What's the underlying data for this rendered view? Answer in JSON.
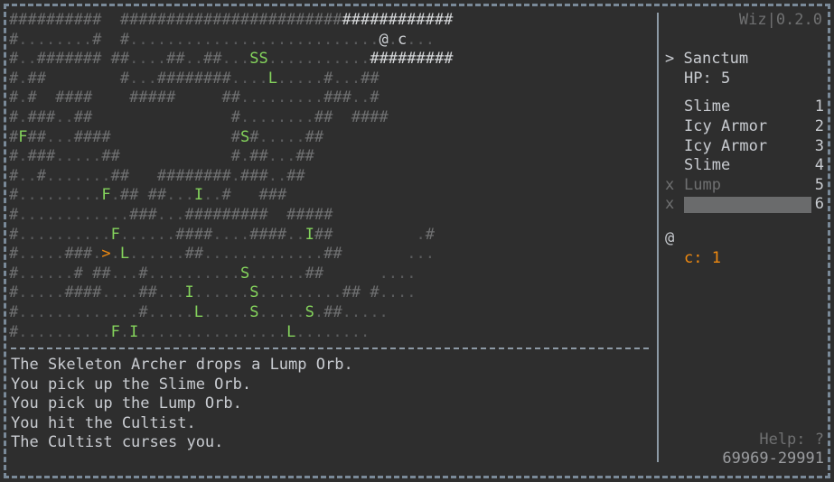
{
  "meta": {
    "version_label": "Wiz|0.2.0"
  },
  "colors": {
    "background": "#2e2e2e",
    "wall": "#6f7071",
    "wall_lit": "#d6d8da",
    "floor": "#5b5c5e",
    "creature_green": "#84d35c",
    "stairs_orange": "#f08a10",
    "text": "#c9ccd1",
    "dim": "#6f7071",
    "border": "#7a8a99"
  },
  "map": {
    "legend": {
      "#": "wall",
      ".": "floor",
      "@": "player",
      "c": "cultist",
      "S": "slime",
      "L": "lump",
      "I": "icy-armor",
      "F": "fire",
      ">": "stairs-down"
    },
    "rows": [
      "##########  ####################################",
      "#........#  #...........................@.c...  ",
      "#..####### ##....##..##...SS...........#########",
      "#.##        #...########....L.....#...##        ",
      "#.#  ####    #####     ##.........###..#        ",
      "#.###..##               #........##  ####       ",
      "#F##...####             #S#.....##              ",
      "#.###.....##            #.##...##               ",
      "#..#.......##   ########.###..##                ",
      "#.........F.## ##...I..#   ###                  ",
      "#............###...#########  #####             ",
      "#..........F......####....####..I##         .#  ",
      "#.....###.>.L......##.............##       ...  ",
      "#......# ##...#..........S......##      ....    ",
      "#.....####....##...I......S.........## #....    ",
      "#.............#.....L.....S.....S.##.....       ",
      "#..........F.I................L........         ",
      "################################################"
    ],
    "highlight_bright": [
      {
        "row": 0,
        "start": 36,
        "end": 48
      },
      {
        "row": 2,
        "start": 38,
        "end": 48
      }
    ],
    "white_chars": [
      {
        "row": 1,
        "col": 40,
        "ch": "@"
      },
      {
        "row": 1,
        "col": 42,
        "ch": "c"
      }
    ]
  },
  "log": {
    "lines": [
      "The Skeleton Archer drops a Lump Orb.",
      "You pick up the Slime Orb.",
      "You pick up the Lump Orb.",
      "You hit the Cultist.",
      "The Cultist curses you."
    ]
  },
  "sidebar": {
    "location": {
      "caret": ">",
      "name": "Sanctum"
    },
    "hp_label": "HP: 5",
    "spells": [
      {
        "disabled": "",
        "name": "Slime",
        "key": "1",
        "hidden": false
      },
      {
        "disabled": "",
        "name": "Icy Armor",
        "key": "2",
        "hidden": false
      },
      {
        "disabled": "",
        "name": "Icy Armor",
        "key": "3",
        "hidden": false
      },
      {
        "disabled": "",
        "name": "Slime",
        "key": "4",
        "hidden": false
      },
      {
        "disabled": "x",
        "name": "Lump",
        "key": "5",
        "hidden": false
      },
      {
        "disabled": "x",
        "name": "",
        "key": "6",
        "hidden": true
      }
    ],
    "player_glyph": "@",
    "effects": [
      {
        "label": "c: 1"
      }
    ],
    "help_label": "Help: ?",
    "seed_label": "69969-29991"
  }
}
